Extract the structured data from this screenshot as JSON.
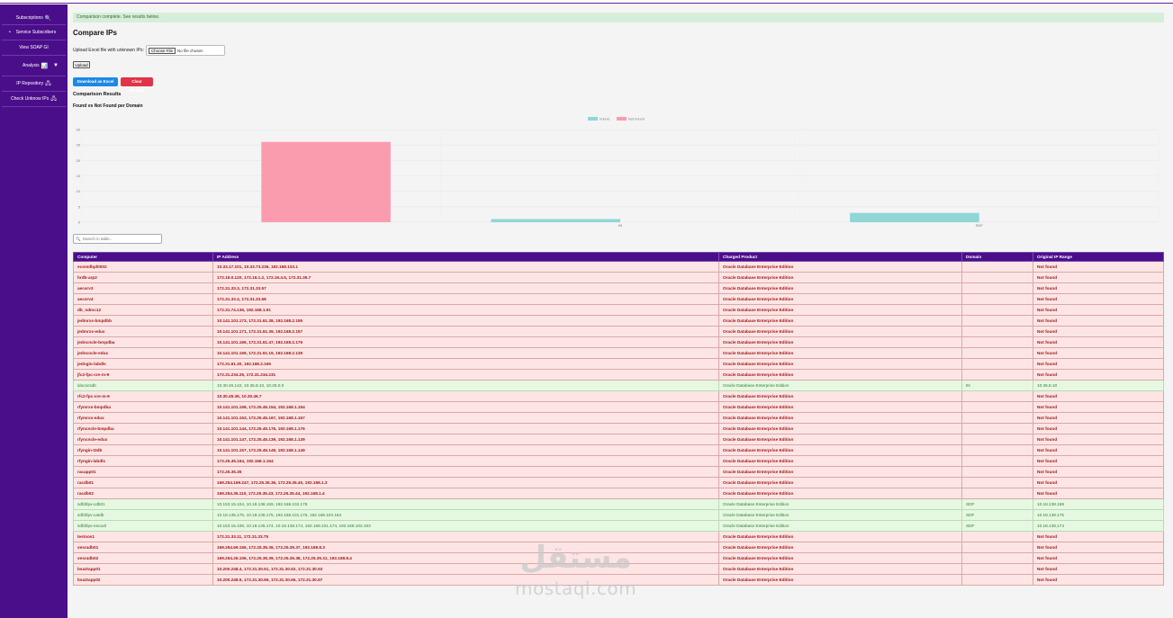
{
  "sidebar": {
    "items": [
      {
        "label": "Subscriptions",
        "icon": "🔍"
      },
      {
        "label": "Service Subscribers",
        "bullet": "•"
      },
      {
        "label": "View SOAP GI"
      },
      {
        "label": "Analysis",
        "icon": "📊",
        "caret": "▼"
      },
      {
        "label": "IP Repository",
        "icon": "🖧"
      },
      {
        "label": "Check Unknow IPs",
        "icon": "🖧"
      }
    ]
  },
  "alert": "Comparison complete. See results below.",
  "page_title": "Compare IPs",
  "upload": {
    "label": "Upload Excel file with unknown IPs:",
    "choose_button": "Choose File",
    "file_status": "No file chosen",
    "submit": "Upload"
  },
  "actions": {
    "download": "Download as Excel",
    "clear": "Clear Results"
  },
  "results_heading": "Comparison Results",
  "chart_heading": "Found vs Not Found per Domain",
  "chart_data": {
    "type": "bar",
    "title": "",
    "categories": [
      "",
      "IN",
      "SDF"
    ],
    "series": [
      {
        "name": "Found",
        "color": "#8fd6d6",
        "values": [
          0,
          1,
          3
        ]
      },
      {
        "name": "Not Found",
        "color": "#fb9cae",
        "values": [
          26,
          0,
          0
        ]
      }
    ],
    "yticks": [
      0,
      5,
      10,
      15,
      20,
      25,
      30
    ],
    "ylim": [
      0,
      30
    ],
    "legend": "top-center",
    "grid": true
  },
  "search": {
    "icon": "🔍",
    "placeholder": "Search in table..."
  },
  "table": {
    "headers": [
      "Computer",
      "IP Address",
      "Charged Product",
      "Domain",
      "Original IP Range"
    ],
    "rows": [
      [
        "ecomdbpl0002",
        "10.33.17.101, 10.33.73.236, 192.168.133.1",
        "Oracle Database Enterprise Edition",
        "",
        "Not found"
      ],
      [
        "hrdb-arp2",
        "172.16.0.120, 172.16.1.2, 172.16.4.5, 172.31.35.7",
        "Oracle Database Enterprise Edition",
        "",
        "Not found"
      ],
      [
        "aecsrv3",
        "172.31.33.3, 172.31.33.57",
        "Oracle Database Enterprise Edition",
        "",
        "Not found"
      ],
      [
        "aecsrv4",
        "172.31.33.4, 172.31.33.68",
        "Oracle Database Enterprise Edition",
        "",
        "Not found"
      ],
      [
        "db_ndmc12",
        "172.31.74.136, 192.168.1.91",
        "Oracle Database Enterprise Edition",
        "",
        "Not found"
      ],
      [
        "jedmrxs-bmpdbb",
        "10.141.101.173, 172.31.61.38, 192.168.2.155",
        "Oracle Database Enterprise Edition",
        "",
        "Not found"
      ],
      [
        "jedmrxs-edux",
        "10.141.101.171, 172.31.61.39, 192.168.2.157",
        "Oracle Database Enterprise Edition",
        "",
        "Not found"
      ],
      [
        "jedncncle-bmpdba",
        "10.141.101.165, 172.31.61.47, 192.168.2.176",
        "Oracle Database Enterprise Edition",
        "",
        "Not found"
      ],
      [
        "jedncncle-edux",
        "10.141.101.169, 172.31.61.19, 192.168.2.139",
        "Oracle Database Enterprise Edition",
        "",
        "Not found"
      ],
      [
        "jedngin-labdls",
        "172.31.61.30, 192.168.2.165",
        "Oracle Database Enterprise Edition",
        "",
        "Not found"
      ],
      [
        "jfc2-fpc-cre-m-9",
        "172.31.234.26, 172.31.234.231",
        "Oracle Database Enterprise Edition",
        "",
        "Not found"
      ],
      [
        "idocscsdb",
        "10.30.46.142, 10.36.8.10, 10.26.0.0",
        "Oracle Database Enterprise Edition",
        "IN",
        "10.36.8.10"
      ],
      [
        "rfc2-fpc-cre-m-9",
        "10.30.45.36, 10.30.46.7",
        "Oracle Database Enterprise Edition",
        "",
        "Not found"
      ],
      [
        "rfymrxs-bmpdba",
        "10.141.101.158, 172.25.45.154, 192.168.1.154",
        "Oracle Database Enterprise Edition",
        "",
        "Not found"
      ],
      [
        "rfymrxs-edux",
        "10.141.101.153, 172.25.45.167, 192.168.1.167",
        "Oracle Database Enterprise Edition",
        "",
        "Not found"
      ],
      [
        "rfyncncle-bmpdba",
        "10.141.101.144, 172.25.45.176, 192.168.1.176",
        "Oracle Database Enterprise Edition",
        "",
        "Not found"
      ],
      [
        "rfyncncle-edux",
        "10.141.101.147, 172.25.45.139, 192.168.1.139",
        "Oracle Database Enterprise Edition",
        "",
        "Not found"
      ],
      [
        "rfyngin-t3db",
        "10.141.101.157, 172.25.45.149, 192.168.1.149",
        "Oracle Database Enterprise Edition",
        "",
        "Not found"
      ],
      [
        "rfyngin-labdls",
        "172.25.45.164, 192.168.1.164",
        "Oracle Database Enterprise Edition",
        "",
        "Not found"
      ],
      [
        "racapp01",
        "172.25.35.35",
        "Oracle Database Enterprise Edition",
        "",
        "Not found"
      ],
      [
        "racdb01",
        "169.254.169.247, 172.25.35.36, 172.25.35.40, 192.168.1.3",
        "Oracle Database Enterprise Edition",
        "",
        "Not found"
      ],
      [
        "racdb02",
        "169.254.35.110, 172.25.35.43, 172.25.35.44, 192.168.1.4",
        "Oracle Database Enterprise Edition",
        "",
        "Not found"
      ],
      [
        "sdfdrlpv-cdb01",
        "10.153.15.104, 10.18.138.169, 192.168.102.178",
        "Oracle Database Enterprise Edition",
        "SDF",
        "10.18.138.169"
      ],
      [
        "sdfdrlpv-catdb",
        "10.18.135.175, 10.18.138.175, 192.168.101.175, 192.168.103.184",
        "Oracle Database Enterprise Edition",
        "SDF",
        "10.18.138.175"
      ],
      [
        "sdfdrlpv-encodr",
        "10.153.15.105, 10.18.135.174, 10.18.138.174, 192.168.101.174, 192.168.102.163",
        "Oracle Database Enterprise Edition",
        "SDF",
        "10.18.138.174"
      ],
      [
        "testsos1",
        "172.31.33.11, 172.31.33.75",
        "Oracle Database Enterprise Edition",
        "",
        "Not found"
      ],
      [
        "vesradb01",
        "169.254.69.156, 172.25.35.36, 172.25.35.37, 192.168.8.3",
        "Oracle Database Enterprise Edition",
        "",
        "Not found"
      ],
      [
        "vesradb02",
        "169.254.26.106, 172.25.35.39, 172.25.35.38, 172.25.35.31, 192.168.8.4",
        "Oracle Database Enterprise Edition",
        "",
        "Not found"
      ],
      [
        "bsaztapp01",
        "10.200.248.4, 172.31.30.51, 172.31.30.52, 172.31.30.53",
        "Oracle Database Enterprise Edition",
        "",
        "Not found"
      ],
      [
        "bsaztapp02",
        "10.200.248.5, 172.31.30.65, 172.31.30.66, 172.31.30.67",
        "Oracle Database Enterprise Edition",
        "",
        "Not found"
      ]
    ]
  },
  "watermark": {
    "arabic": "مستقل",
    "latin": "mostaql.com"
  }
}
